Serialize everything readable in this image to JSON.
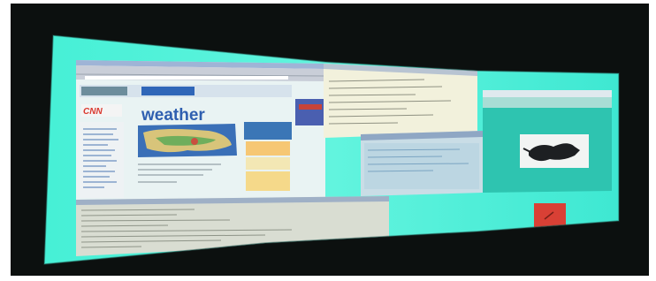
{
  "photo": {
    "brand_label": "weather",
    "site_label": "CNN",
    "colors": {
      "room": "#0c100f",
      "frame": "#ffffff",
      "desktop": "#3ff0d8",
      "desktop_light": "#7ff6e6",
      "browser_bg": "#e9f3f3",
      "toolbar": "#c9ced8",
      "map_blue": "#3a6fb7",
      "logo_red": "#d9382e",
      "accent_square": "#d94035",
      "window_teal": "#2ec4b0"
    }
  }
}
